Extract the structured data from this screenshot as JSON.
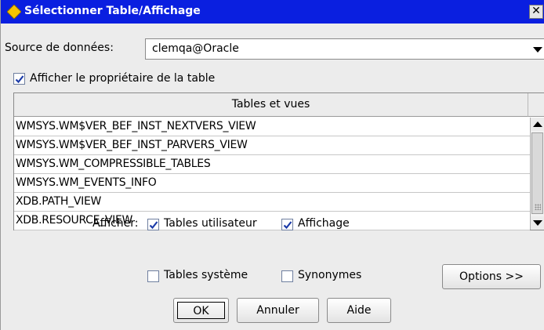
{
  "window": {
    "title": "Sélectionner Table/Affichage",
    "close_glyph": "✕"
  },
  "source": {
    "label": "Source de données:",
    "value": "clemqa@Oracle"
  },
  "show_owner": {
    "label": "Afficher le propriétaire de la table",
    "checked": true
  },
  "table": {
    "header": "Tables et vues",
    "rows": [
      "WMSYS.WM$VER_BEF_INST_NEXTVERS_VIEW",
      "WMSYS.WM$VER_BEF_INST_PARVERS_VIEW",
      "WMSYS.WM_COMPRESSIBLE_TABLES",
      "WMSYS.WM_EVENTS_INFO",
      "XDB.PATH_VIEW",
      "XDB.RESOURCE_VIEW"
    ]
  },
  "filters": {
    "show_label": "Afficher:",
    "user_tables": {
      "label": "Tables utilisateur",
      "checked": true
    },
    "views": {
      "label": "Affichage",
      "checked": true
    },
    "system_tables": {
      "label": "Tables système",
      "checked": false
    },
    "synonyms": {
      "label": "Synonymes",
      "checked": false
    }
  },
  "buttons": {
    "options": "Options >>",
    "ok": "OK",
    "cancel": "Annuler",
    "help": "Aide"
  },
  "colors": {
    "titlebar": "#0a1fe0",
    "dialog_bg": "#ececec",
    "check": "#1a3aa8"
  }
}
